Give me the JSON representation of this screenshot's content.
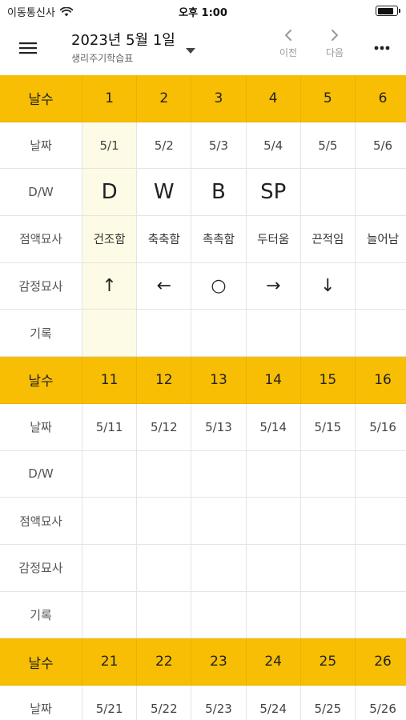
{
  "status_bar": {
    "carrier": "이동통신사",
    "time": "오후 1:00",
    "battery_level": 0.9
  },
  "header": {
    "title": "2023년 5월 1일",
    "subtitle": "생리주기학습표",
    "prev_label": "이전",
    "next_label": "다음"
  },
  "colors": {
    "header_row_bg": "#f7be03",
    "highlight_col_bg": "#fdfbe6"
  },
  "row_labels": {
    "day_count": "날수",
    "date": "날짜",
    "dw": "D/W",
    "mucus": "점액묘사",
    "emotion": "감정묘사",
    "record": "기록"
  },
  "blocks": [
    {
      "days": [
        "1",
        "2",
        "3",
        "4",
        "5",
        "6"
      ],
      "dates": [
        "5/1",
        "5/2",
        "5/3",
        "5/4",
        "5/5",
        "5/6"
      ],
      "dw": [
        "D",
        "W",
        "B",
        "SP",
        "",
        ""
      ],
      "mucus": [
        "건조함",
        "축축함",
        "촉촉함",
        "두터움",
        "끈적임",
        "늘어남"
      ],
      "emotion": [
        "↑",
        "←",
        "○",
        "→",
        "↓",
        ""
      ],
      "record": [
        "",
        "",
        "",
        "",
        "",
        ""
      ]
    },
    {
      "days": [
        "11",
        "12",
        "13",
        "14",
        "15",
        "16"
      ],
      "dates": [
        "5/11",
        "5/12",
        "5/13",
        "5/14",
        "5/15",
        "5/16"
      ],
      "dw": [
        "",
        "",
        "",
        "",
        "",
        ""
      ],
      "mucus": [
        "",
        "",
        "",
        "",
        "",
        ""
      ],
      "emotion": [
        "",
        "",
        "",
        "",
        "",
        ""
      ],
      "record": [
        "",
        "",
        "",
        "",
        "",
        ""
      ]
    },
    {
      "days": [
        "21",
        "22",
        "23",
        "24",
        "25",
        "26"
      ],
      "dates": [
        "5/21",
        "5/22",
        "5/23",
        "5/24",
        "5/25",
        "5/26"
      ]
    }
  ]
}
